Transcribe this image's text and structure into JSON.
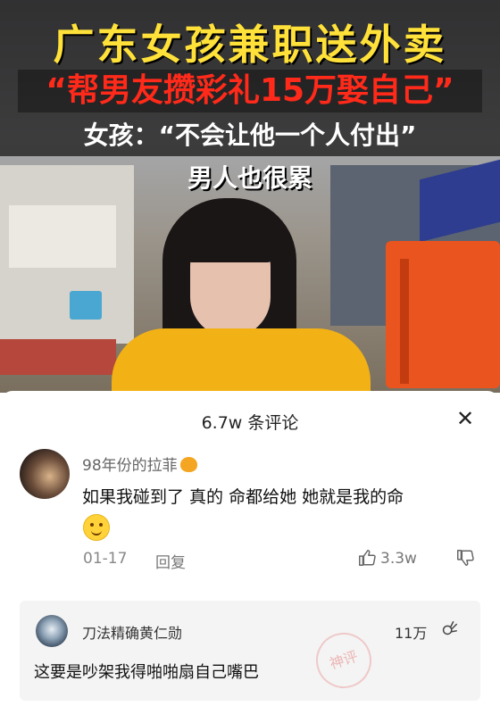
{
  "video": {
    "headline": "广东女孩兼职送外卖",
    "subheadline": "“帮男友攒彩礼15万娶自己”",
    "quote": "女孩：“不会让他一个人付出”",
    "quote2": "男人也很累"
  },
  "comments_panel": {
    "title": "6.7w 条评论",
    "close_icon": "close-icon"
  },
  "comment": {
    "username": "98年份的拉菲",
    "username_badge_icon": "tiger-icon",
    "text": "如果我碰到了 真的 命都给她 她就是我的命",
    "emoji_icon": "smile-emoji-icon",
    "date": "01-17",
    "reply_label": "回复",
    "like_count": "3.3w"
  },
  "reply": {
    "username": "刀法精确黄仁勋",
    "like_count": "11万",
    "text": "这要是吵架我得啪啪扇自己嘴巴",
    "stamp": "神评"
  }
}
